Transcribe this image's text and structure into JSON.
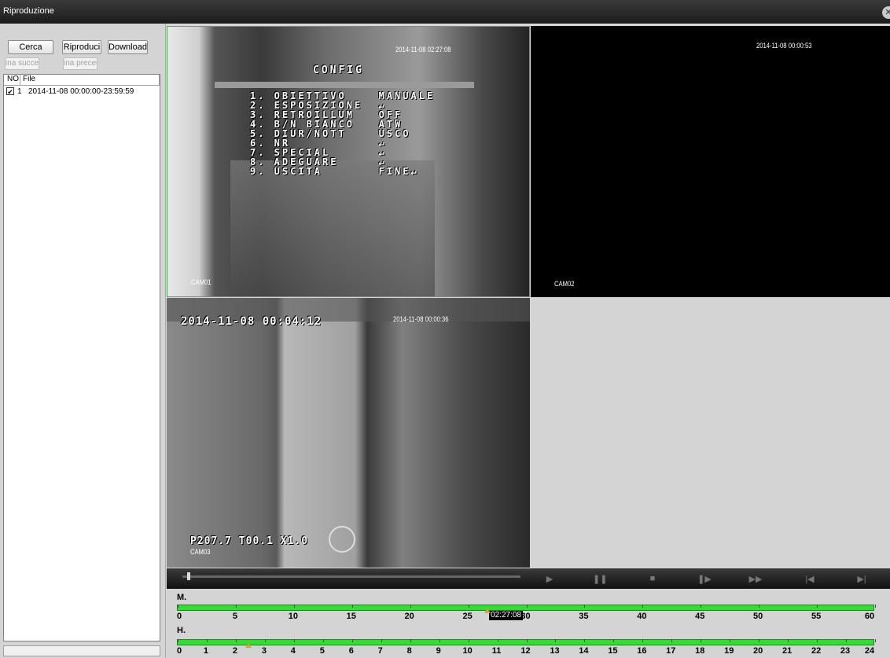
{
  "window": {
    "title": "Riproduzione"
  },
  "toolbar": {
    "search_label": "Cerca",
    "play_label": "Riproduci",
    "download_label": "Download",
    "next_page_label": "ina succes",
    "prev_page_label": "ina preced"
  },
  "filelist": {
    "columns": [
      "NO",
      "File"
    ],
    "rows": [
      {
        "no": "1",
        "file": "2014-11-08 00:00:00-23:59:59",
        "checked": true
      }
    ]
  },
  "videos": {
    "cam1": {
      "timestamp": "2014-11-08 02:27:08",
      "label": "CAM01",
      "osd_title": "CONFIG",
      "osd_lines": [
        "1. OBIETTIVO    MANUALE",
        "2. ESPOSIZIONE  ↵",
        "3. RETROILLUM   OFF",
        "4. B/N BIANCO   ATW",
        "5. DIUR/NOTT    USCO",
        "6. NR           ↵",
        "7. SPECIAL      ↵",
        "8. ADEGUARE     ↵",
        "9. USCITA       FINE↵"
      ]
    },
    "cam2": {
      "timestamp": "2014-11-08 00:00:53",
      "label": "CAM02"
    },
    "cam3": {
      "timestamp": "2014-11-08 00:00:36",
      "osd_time": "2014-11-08 00:04:12",
      "ptz": "P207.7 T00.1 X1.0",
      "label": "CAM03"
    }
  },
  "timeline": {
    "minutes_label": "M.",
    "hours_label": "H.",
    "minute_ticks": [
      "0",
      "5",
      "10",
      "15",
      "20",
      "25",
      "30",
      "35",
      "40",
      "45",
      "50",
      "55",
      "60"
    ],
    "hour_ticks": [
      "0",
      "1",
      "2",
      "3",
      "4",
      "5",
      "6",
      "7",
      "8",
      "9",
      "10",
      "11",
      "12",
      "13",
      "14",
      "15",
      "16",
      "17",
      "18",
      "19",
      "20",
      "21",
      "22",
      "23",
      "24"
    ],
    "current_time": "02:27:08",
    "current_minute": 27.13,
    "current_hour": 2.45
  },
  "colors": {
    "timeline_bar": "#33dd33",
    "marker": "#e8a020",
    "selected_border": "#4caf50"
  }
}
